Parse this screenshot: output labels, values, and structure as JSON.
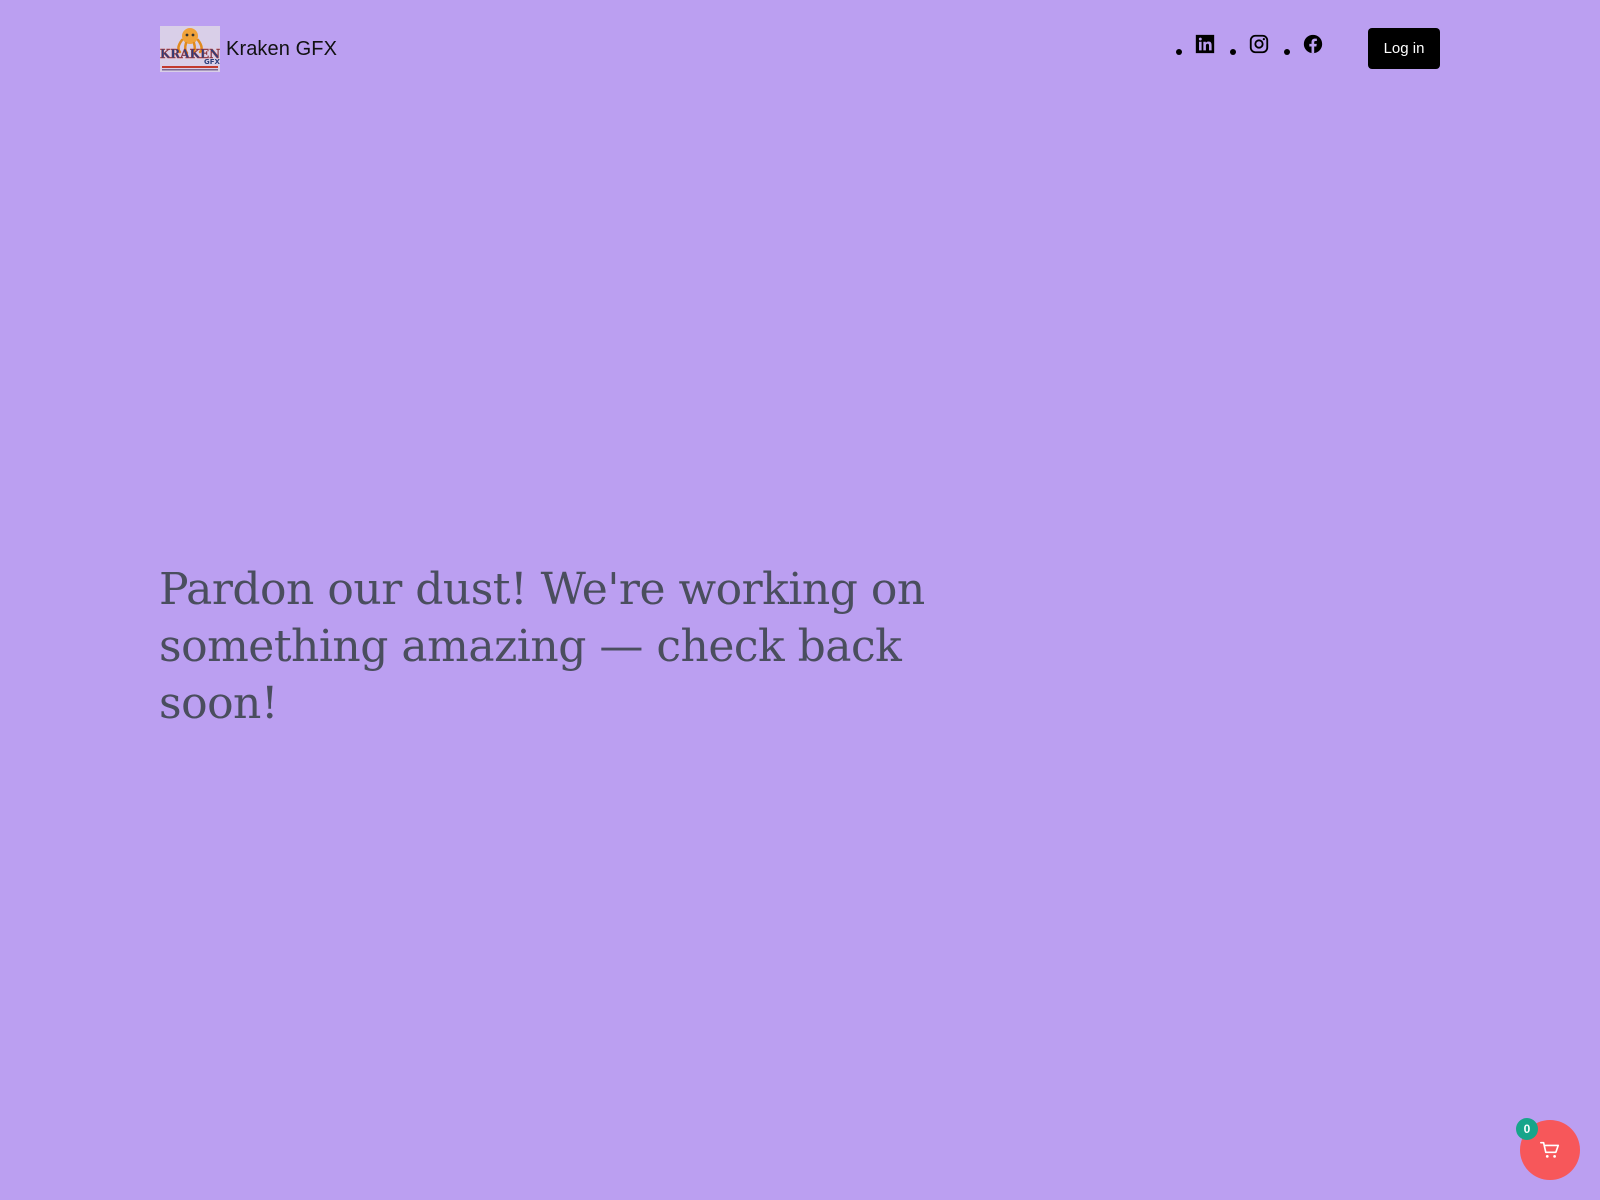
{
  "site": {
    "name": "Kraken GFX",
    "logo_alt": "Kraken GFX logo"
  },
  "header": {
    "social_links": [
      {
        "icon": "linkedin-icon"
      },
      {
        "icon": "instagram-icon"
      },
      {
        "icon": "facebook-icon"
      }
    ],
    "login_label": "Log in"
  },
  "main": {
    "headline": "Pardon our dust! We're working on something amazing — check back soon!"
  },
  "cart": {
    "icon": "cart-icon",
    "count": "0"
  },
  "colors": {
    "background": "#bb9ff1",
    "headline_text": "#4a4e5e",
    "button": "#000000",
    "cart_button": "#f7575a",
    "cart_badge": "#17a58a"
  }
}
